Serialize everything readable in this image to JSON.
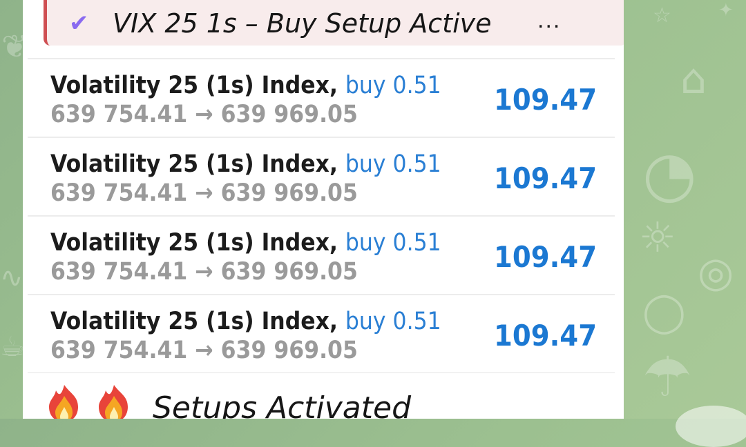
{
  "reply": {
    "check_icon": "check-icon",
    "title": "VIX 25 1s – Buy Setup Active",
    "more": "..."
  },
  "trades": [
    {
      "instrument": "Volatility 25 (1s) Index,",
      "side": "buy 0.51",
      "open_price": "639 754.41",
      "arrow": "→",
      "close_price": "639 969.05",
      "profit": "109.47"
    },
    {
      "instrument": "Volatility 25 (1s) Index,",
      "side": "buy 0.51",
      "open_price": "639 754.41",
      "arrow": "→",
      "close_price": "639 969.05",
      "profit": "109.47"
    },
    {
      "instrument": "Volatility 25 (1s) Index,",
      "side": "buy 0.51",
      "open_price": "639 754.41",
      "arrow": "→",
      "close_price": "639 969.05",
      "profit": "109.47"
    },
    {
      "instrument": "Volatility 25 (1s) Index,",
      "side": "buy 0.51",
      "open_price": "639 754.41",
      "arrow": "→",
      "close_price": "639 969.05",
      "profit": "109.47"
    }
  ],
  "footer": {
    "emoji_icon": "fire-icon",
    "label": "Setups Activated"
  },
  "colors": {
    "accent_blue": "#1b78d2",
    "reply_bar": "#cf4f52",
    "check": "#8a6af0",
    "background_green": "#9cc090"
  }
}
